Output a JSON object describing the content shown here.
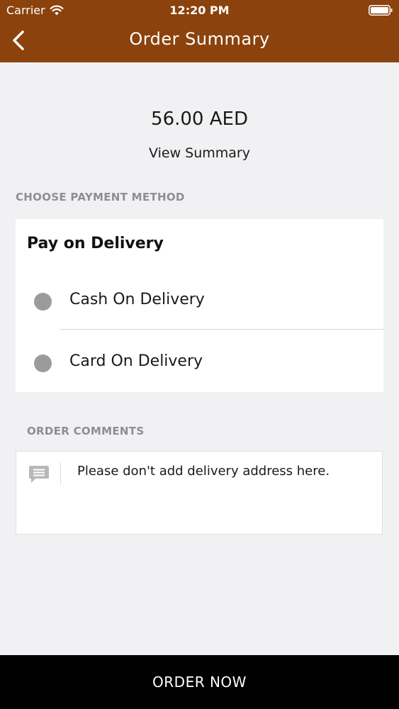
{
  "status_bar": {
    "carrier": "Carrier",
    "time": "12:20 PM"
  },
  "nav": {
    "title": "Order Summary",
    "back_icon": "chevron-left-icon"
  },
  "summary": {
    "amount": "56.00 AED",
    "view_summary_label": "View Summary"
  },
  "payment": {
    "section_label": "CHOOSE PAYMENT METHOD",
    "card_title": "Pay on Delivery",
    "options": [
      {
        "label": "Cash On Delivery",
        "selected": false
      },
      {
        "label": "Card On Delivery",
        "selected": false
      }
    ]
  },
  "comments": {
    "section_label": "ORDER COMMENTS",
    "placeholder": "Please don't add delivery address here.",
    "icon": "comment-icon"
  },
  "footer": {
    "order_button_label": "ORDER NOW"
  },
  "colors": {
    "header_bg": "#8b420c",
    "page_bg": "#f1f1f3",
    "radio": "#9b9b9b",
    "section_label": "#8e8e93",
    "order_button_bg": "#000000"
  }
}
